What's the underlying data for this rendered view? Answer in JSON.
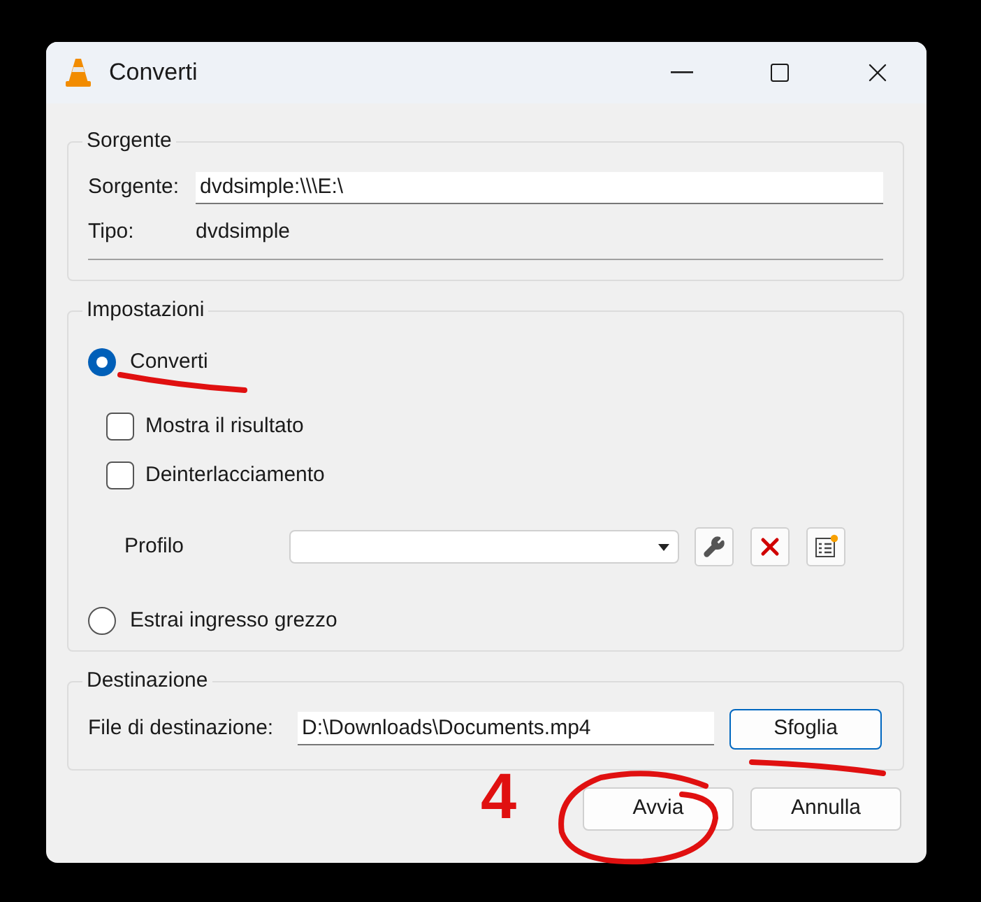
{
  "window": {
    "title": "Converti"
  },
  "source": {
    "legend": "Sorgente",
    "source_label": "Sorgente:",
    "source_value": "dvdsimple:\\\\\\E:\\",
    "type_label": "Tipo:",
    "type_value": "dvdsimple"
  },
  "settings": {
    "legend": "Impostazioni",
    "convert": {
      "label": "Converti",
      "selected": true
    },
    "checkboxes": [
      {
        "label": "Mostra il risultato",
        "checked": false
      },
      {
        "label": "Deinterlacciamento",
        "checked": false
      }
    ],
    "profile": {
      "label": "Profilo"
    },
    "raw": {
      "label": "Estrai ingresso grezzo",
      "selected": false
    }
  },
  "destination": {
    "legend": "Destinazione",
    "file_label": "File di destinazione:",
    "file_value": "D:\\Downloads\\Documents.mp4",
    "browse": "Sfoglia"
  },
  "buttons": [
    "Avvia",
    "Annulla"
  ],
  "annotation": {
    "label": "4"
  }
}
